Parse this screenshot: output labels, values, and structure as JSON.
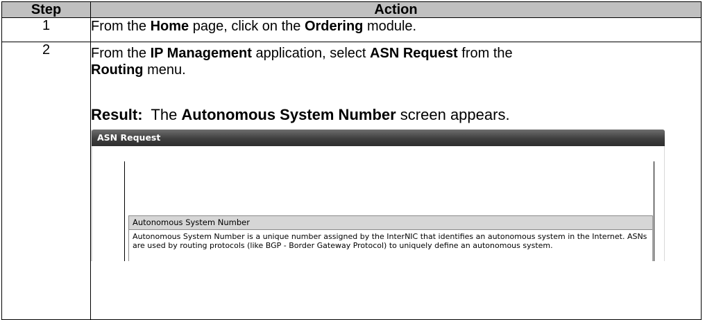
{
  "table": {
    "col_step": "Step",
    "col_action": "Action",
    "row1": {
      "step": "1",
      "t1": "From the ",
      "b1": "Home",
      "t2": " page, click on the ",
      "b2": "Ordering",
      "t3": " module."
    },
    "row2": {
      "step": "2",
      "t1": "From the ",
      "b1": "IP Management",
      "t2": " application, select ",
      "b2": "ASN Request",
      "t3": " from the ",
      "b3": "Routing",
      "t4": " menu.",
      "result_label": "Result:",
      "result_t1": "  The ",
      "result_b1": "Autonomous System Number",
      "result_t2": " screen appears."
    }
  },
  "screenshot": {
    "window_title": "ASN Request",
    "panel_title": "Autonomous System Number",
    "panel_text": "Autonomous System Number is a unique number assigned by the InterNIC that identifies an autonomous system in the Internet. ASNs are used by routing protocols (like BGP - Border Gateway Protocol) to uniquely define an autonomous system."
  }
}
